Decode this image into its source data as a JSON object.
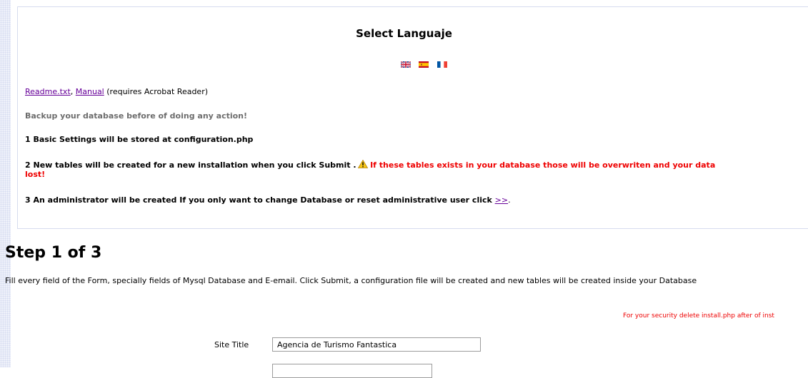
{
  "header": {
    "title": "Select Languaje",
    "flags": [
      "English",
      "Español",
      "Français"
    ]
  },
  "links": {
    "readme": "Readme.txt",
    "separator": ", ",
    "manual": "Manual",
    "manual_note": " (requires Acrobat Reader)"
  },
  "notices": {
    "backup": "Backup your database before of doing any action!",
    "step1": "1 Basic Settings will be stored at configuration.php",
    "step2": "2 New tables will be created for a new installation when you click Submit .",
    "step2_warning_a": "If these tables exists in your database those will be overwriten and your data",
    "step2_warning_b": "lost!",
    "step3": "3 An administrator will be created If you only want to change Database or reset administrative user click ",
    "step3_link": ">>",
    "step3_end": "."
  },
  "step": {
    "title": "Step 1 of 3",
    "description": "Fill every field of the Form, specially fields of Mysql Database and E-email. Click Submit, a configuration file will be created and new tables will be created inside your Database",
    "security_note": "For your security delete install.php after of inst"
  },
  "form": {
    "site_title_label": "Site Title",
    "site_title_value": "Agencia de Turismo Fantastica"
  },
  "colors": {
    "link": "#660099",
    "warning": "#ee0000",
    "box_border": "#d6dcee"
  },
  "icons": [
    "uk-flag-icon",
    "spain-flag-icon",
    "france-flag-icon",
    "warning-icon"
  ]
}
